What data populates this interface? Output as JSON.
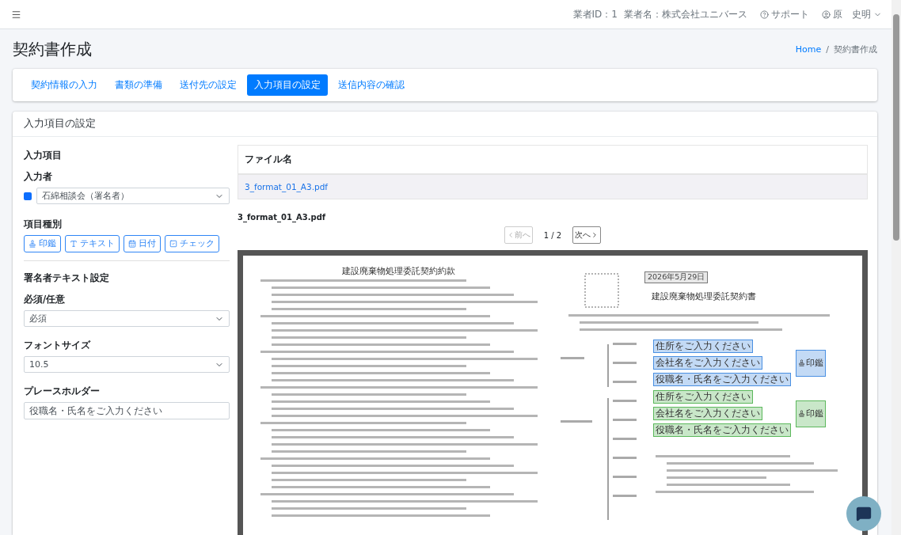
{
  "header": {
    "vendor_id": "業者ID：1",
    "vendor_name": "業者名：株式会社ユニバース",
    "support": "サポート",
    "user": "原　史明"
  },
  "page": {
    "title": "契約書作成",
    "breadcrumb": {
      "items": [
        "Home",
        "契約書作成"
      ],
      "separator": "/"
    }
  },
  "steps": [
    {
      "label": "契約情報の入力",
      "selected": false
    },
    {
      "label": "書類の準備",
      "selected": false
    },
    {
      "label": "送付先の設定",
      "selected": false
    },
    {
      "label": "入力項目の設定",
      "selected": true
    },
    {
      "label": "送信内容の確認",
      "selected": false
    }
  ],
  "panel": {
    "title": "入力項目の設定",
    "section": "入力項目",
    "inputter": {
      "label": "入力者",
      "value": "石綿相談会（署名者）",
      "color": "#0d6efd"
    },
    "item_types": {
      "label": "項目種別",
      "buttons": [
        {
          "kind": "stamp",
          "label": "印鑑"
        },
        {
          "kind": "text",
          "label": "テキスト"
        },
        {
          "kind": "date",
          "label": "日付"
        },
        {
          "kind": "check",
          "label": "チェック"
        }
      ]
    },
    "settings": {
      "title": "署名者テキスト設定",
      "fields": [
        {
          "kind": "select",
          "label": "必須/任意",
          "value": "必須"
        },
        {
          "kind": "select",
          "label": "フォントサイズ",
          "value": "10.5"
        },
        {
          "kind": "input",
          "label": "プレースホルダー",
          "value": "役職名・氏名をご入力ください"
        }
      ]
    }
  },
  "files": {
    "column": "ファイル名",
    "rows": [
      "3_format_01_A3.pdf"
    ]
  },
  "viewer": {
    "file_name": "3_format_01_A3.pdf",
    "prev": "前へ",
    "prev_disabled": true,
    "page": "1 / 2",
    "next": "次へ",
    "next_disabled": false
  },
  "document": {
    "left_title": "建設廃棄物処理委託契約約款",
    "right_title": "建設廃棄物処理委託契約書",
    "date_field": "2026年5月29日",
    "parties": [
      {
        "color": "#4a90e2",
        "fields": [
          "住所をご入力ください",
          "会社名をご入力ください",
          "役職名・氏名をご入力ください"
        ],
        "stamp": "印鑑"
      },
      {
        "color": "#5cb85c",
        "fields": [
          "住所をご入力ください",
          "会社名をご入力ください",
          "役職名・氏名をご入力ください"
        ],
        "stamp": "印鑑"
      }
    ]
  }
}
